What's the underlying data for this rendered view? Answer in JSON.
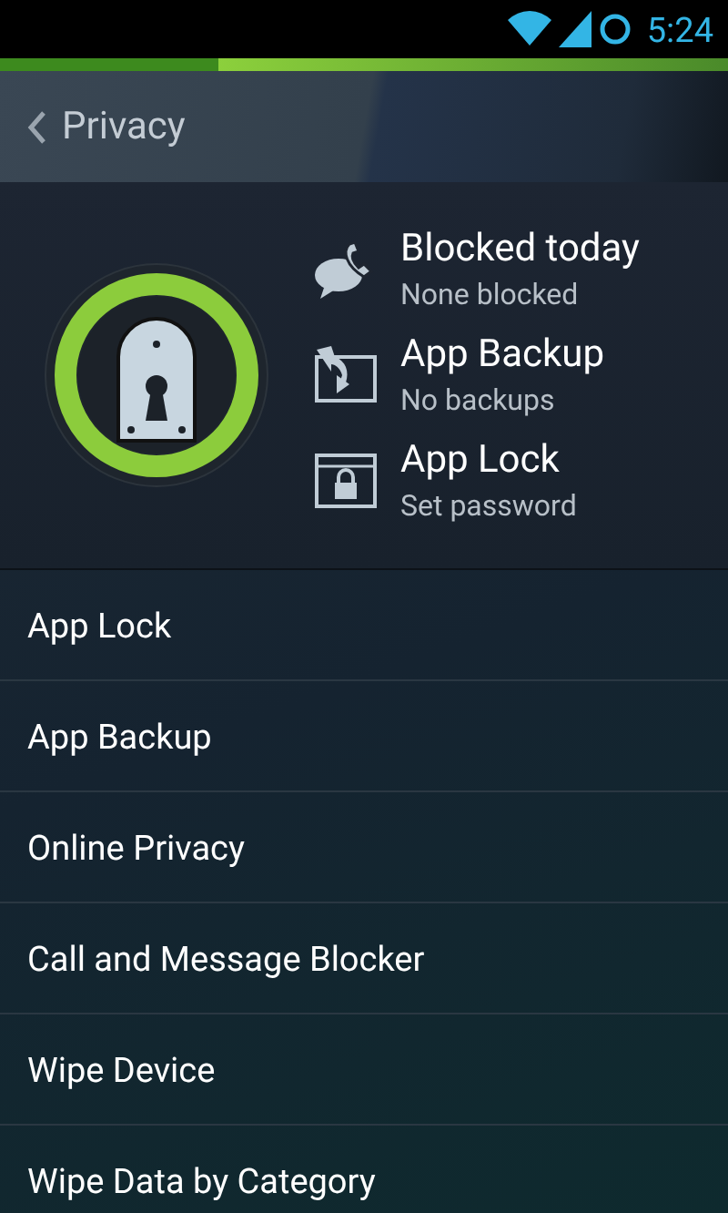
{
  "status_bar": {
    "time": "5:24"
  },
  "header": {
    "title": "Privacy"
  },
  "summary": [
    {
      "kind": "calls",
      "title": "Blocked today",
      "subtitle": "None blocked"
    },
    {
      "kind": "backup",
      "title": "App Backup",
      "subtitle": "No backups"
    },
    {
      "kind": "lock",
      "title": "App Lock",
      "subtitle": "Set password"
    }
  ],
  "menu": [
    {
      "label": "App Lock"
    },
    {
      "label": "App Backup"
    },
    {
      "label": "Online Privacy"
    },
    {
      "label": "Call and Message Blocker"
    },
    {
      "label": "Wipe Device"
    },
    {
      "label": "Wipe Data by Category"
    }
  ]
}
